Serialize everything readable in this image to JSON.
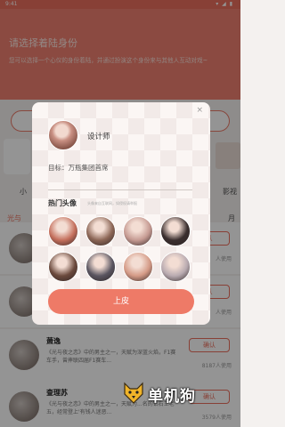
{
  "status": {
    "time": "9:41",
    "right": "▾ ◢ ▮"
  },
  "header": {
    "title": "请选择着陆身份",
    "desc": "您可以选择一个心仪的身份着陆，并通过扮演这个身份来与其他人互动对戏~"
  },
  "bg_tabs": {
    "small": "小",
    "film": "影视",
    "moon": "月香",
    "active": "光与"
  },
  "list": [
    {
      "name": "",
      "info": "",
      "btn": "认",
      "uses": "人使用"
    },
    {
      "name": "",
      "info": "",
      "btn": "认",
      "uses": "人使用"
    },
    {
      "name": "萧逸",
      "info": "《光与夜之恋》中的男主之一，天赋为深蓝火焰，F1赛车手，曾摔联四届F1赛车...",
      "btn": "确认",
      "uses": "8187人使用"
    },
    {
      "name": "查理苏",
      "info": "《光与夜之恋》中的男主之一，天赋为...名的钻石王老五，经常登上'有钱人迷恶...",
      "btn": "确认",
      "uses": "3579人使用"
    }
  ],
  "dialog": {
    "close": "×",
    "me_name": "设计师",
    "goal": "目标：万瓶集团首席",
    "hot_title": "热门头像",
    "hot_tip": "头像来自互联网，如侵权请举报",
    "confirm": "上皮"
  },
  "avatars": [
    {
      "color": "#c46f5c"
    },
    {
      "color": "#8c6656"
    },
    {
      "color": "#c59a92"
    },
    {
      "color": "#3a2e2e"
    },
    {
      "color": "#6b4a3d"
    },
    {
      "color": "#5a5560"
    },
    {
      "color": "#d49a86"
    },
    {
      "color": "#b8aab0"
    }
  ],
  "watermark": {
    "text": "单机狗"
  }
}
